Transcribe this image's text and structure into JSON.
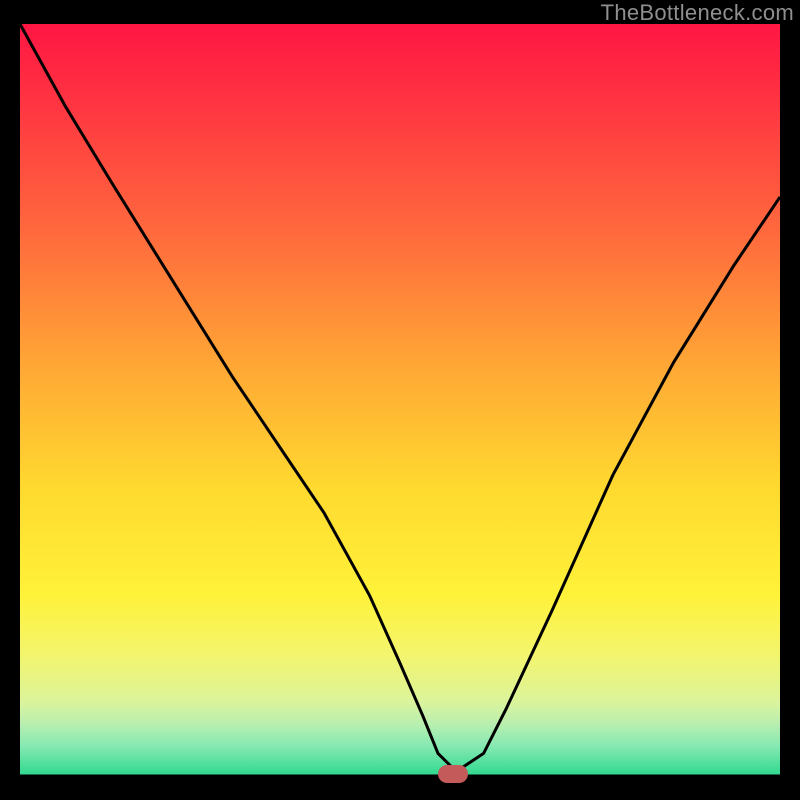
{
  "watermark": "TheBottleneck.com",
  "chart_data": {
    "type": "line",
    "title": "",
    "xlabel": "",
    "ylabel": "",
    "xlim": [
      0,
      100
    ],
    "ylim": [
      0,
      100
    ],
    "grid": false,
    "legend": {
      "show": false
    },
    "background_gradient": {
      "stops": [
        {
          "offset": 0.0,
          "color": "#ff1643"
        },
        {
          "offset": 0.1,
          "color": "#ff3342"
        },
        {
          "offset": 0.28,
          "color": "#ff6a3d"
        },
        {
          "offset": 0.46,
          "color": "#ffa935"
        },
        {
          "offset": 0.62,
          "color": "#ffda2f"
        },
        {
          "offset": 0.76,
          "color": "#fff23a"
        },
        {
          "offset": 0.84,
          "color": "#f3f56e"
        },
        {
          "offset": 0.9,
          "color": "#dcf49a"
        },
        {
          "offset": 0.93,
          "color": "#baefb0"
        },
        {
          "offset": 0.96,
          "color": "#86e9b2"
        },
        {
          "offset": 1.0,
          "color": "#2dd88f"
        }
      ]
    },
    "series": [
      {
        "name": "bottleneck-curve",
        "color": "#000000",
        "stroke_width": 3,
        "x": [
          0,
          6,
          12,
          20,
          28,
          34,
          40,
          46,
          50,
          53,
          55,
          57,
          58,
          61,
          64,
          70,
          78,
          86,
          94,
          100
        ],
        "y": [
          100,
          89,
          79,
          66,
          53,
          44,
          35,
          24,
          15,
          8,
          3,
          1,
          1,
          3,
          9,
          22,
          40,
          55,
          68,
          77
        ]
      }
    ],
    "baseline": {
      "y": 0,
      "color": "#000000",
      "stroke_width": 3
    },
    "marker": {
      "name": "optimal-point",
      "x": 57,
      "y": 0,
      "color": "#c45a5a",
      "shape": "pill"
    }
  }
}
